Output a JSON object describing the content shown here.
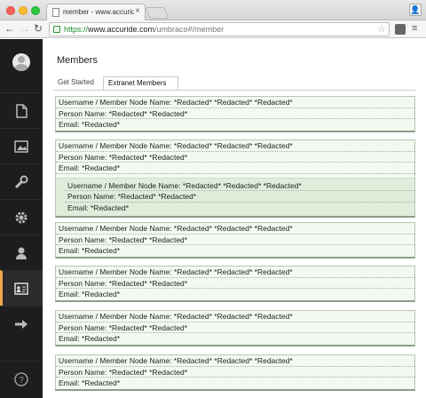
{
  "browser": {
    "tab_title": "member - www.accuride.c",
    "url_scheme": "https://",
    "url_host": "www.accuride.com",
    "url_path": "/umbraco#/member"
  },
  "page": {
    "title": "Members",
    "tabs": [
      "Get Started",
      "Extranet Members"
    ]
  },
  "labels": {
    "username": "Username / Member Node Name:",
    "person": "Person Name:",
    "email": "Email:"
  },
  "members": [
    {
      "username": "*Redacted* *Redacted* *Redacted*",
      "person": "*Redacted* *Redacted*",
      "email": "*Redacted*"
    },
    {
      "username": "*Redacted* *Redacted* *Redacted*",
      "person": "*Redacted* *Redacted*",
      "email": "*Redacted*",
      "nested": {
        "username": "*Redacted* *Redacted* *Redacted*",
        "person": "*Redacted* *Redacted*",
        "email": "*Redacted*"
      }
    },
    {
      "username": "*Redacted* *Redacted* *Redacted*",
      "person": "*Redacted* *Redacted*",
      "email": "*Redacted*"
    },
    {
      "username": "*Redacted* *Redacted* *Redacted*",
      "person": "*Redacted* *Redacted*",
      "email": "*Redacted*"
    },
    {
      "username": "*Redacted* *Redacted* *Redacted*",
      "person": "*Redacted* *Redacted*",
      "email": "*Redacted*"
    },
    {
      "username": "*Redacted* *Redacted* *Redacted*",
      "person": "*Redacted* *Redacted*",
      "email": "*Redacted*"
    }
  ],
  "sidebar": {
    "sections": [
      "content-icon",
      "media-icon",
      "developer-icon",
      "settings-icon",
      "users-icon",
      "members-icon",
      "forms-icon",
      "help-icon"
    ],
    "active": "members-icon",
    "accent": "#f2a74b"
  }
}
